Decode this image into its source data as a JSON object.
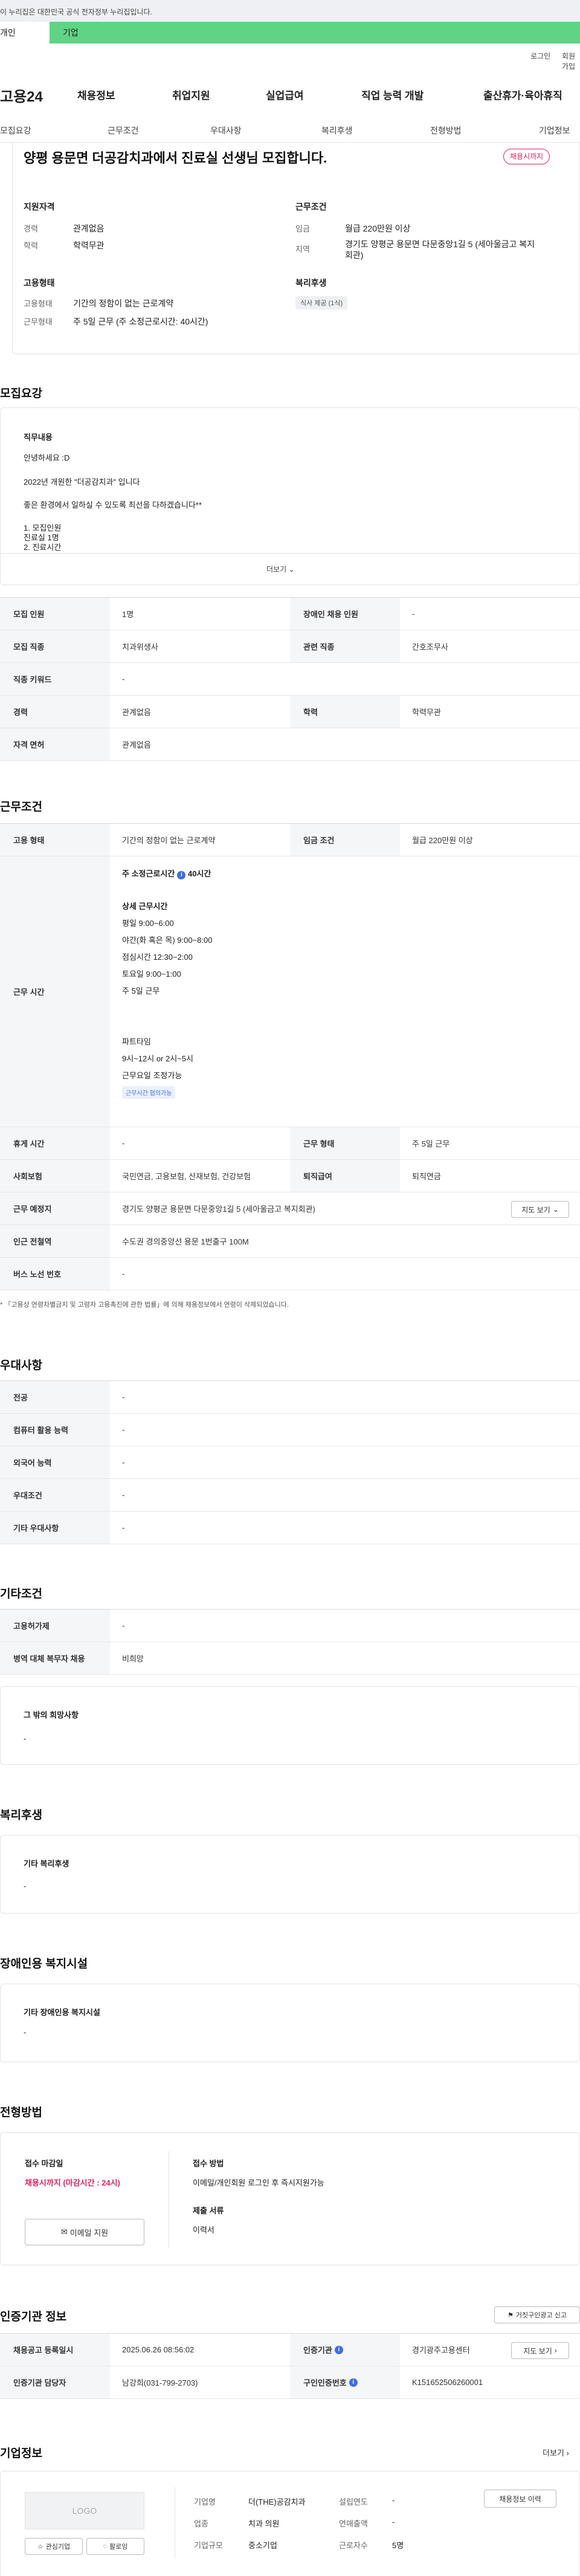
{
  "gov_banner": "이 누리집은 대한민국 공식 전자정부 누리집입니다.",
  "top_tabs": {
    "individual": "개인",
    "corporate": "기업"
  },
  "util": {
    "login": "로그인",
    "join": "회원가입"
  },
  "gnb": {
    "logo": "고용24",
    "menu": [
      "채용정보",
      "취업지원",
      "실업급여",
      "직업 능력 개발",
      "출산휴가·육아휴직"
    ]
  },
  "lnb": [
    "모집요강",
    "근무조건",
    "우대사항",
    "복리후생",
    "전형방법",
    "기업정보"
  ],
  "summary": {
    "title": "양평 용문면 더공감치과에서 진료실 선생님 모집합니다.",
    "deadline_badge": "채용시까지",
    "qual_title": "지원자격",
    "cond_title": "근무조건",
    "career_k": "경력",
    "career_v": "관계없음",
    "edu_k": "학력",
    "edu_v": "학력무관",
    "wage_k": "임금",
    "wage_v": "월급 220만원 이상",
    "region_k": "지역",
    "region_v1": "경기도 양평군 용문면 다문중앙1길 5 (세아울금고 복지",
    "region_v2": "회관)",
    "emp_title": "고용형태",
    "welfare_title": "복리후생",
    "emptype_k": "고용형태",
    "emptype_v": "기간의 정함이 없는 근로계약",
    "worktype_k": "근무형태",
    "worktype_v": "주 5일 근무 (주 소정근로시간: 40시간)",
    "welfare_chip": "식사 제공 (1식)"
  },
  "recruit": {
    "section_title": "모집요강",
    "duty_title": "직무내용",
    "lines": [
      "안녕하세요 :D",
      "2022년 개원한 \"더공감치과\" 입니다",
      "좋은 환경에서 일하실 수 있도록 최선을 다하겠습니다**",
      "1. 모집인원",
      "진료실 1명",
      "2. 진료시간"
    ],
    "more": "더보기",
    "rows": [
      {
        "k1": "모집 인원",
        "v1": "1명",
        "k2": "장애인 채용 인원",
        "v2": "-"
      },
      {
        "k1": "모집 직종",
        "v1": "치과위생사",
        "k2": "관련 직종",
        "v2": "간호조무사"
      },
      {
        "k1": "직종 키워드",
        "v1": "-"
      },
      {
        "k1": "경력",
        "v1": "관계없음",
        "k2": "학력",
        "v2": "학력무관"
      },
      {
        "k1": "자격 면허",
        "v1": "관계없음"
      }
    ]
  },
  "conditions": {
    "section_title": "근무조건",
    "emp_k": "고용 형태",
    "emp_v": "기간의 정함이 없는 근로계약",
    "wage_k": "임금 조건",
    "wage_v": "월급 220만원 이상",
    "time_k": "근무 시간",
    "time_head": "주 소정근로시간",
    "time_head_v": "40시간",
    "detail_title": "상세 근무시간",
    "detail_lines": [
      "평일 9:00~6:00",
      "야간(화 혹은 목) 9:00~8:00",
      "점심시간 12:30~2:00",
      "토요일 9:00~1:00",
      "주 5일 근무",
      "",
      "파트타임",
      "9시~12시 or 2시~5시",
      "근무요일 조정가능"
    ],
    "parttime_badge": "근무시간 협의가능",
    "rest_k": "휴게 시간",
    "rest_v": "-",
    "form_k": "근무 형태",
    "form_v": "주 5일 근무",
    "ins_k": "사회보험",
    "ins_v": "국민연금, 고용보험, 산재보험, 건강보험",
    "sev_k": "퇴직급여",
    "sev_v": "퇴직연금",
    "place_k": "근무 예정지",
    "place_v": "경기도 양평군 용문면 다문중앙1길 5 (세아울금고 복지회관)",
    "map_btn": "지도 보기",
    "subway_k": "인근 전철역",
    "subway_v": "수도권 경의중앙선 용문 1번출구 100M",
    "bus_k": "버스 노선 번호",
    "bus_v": "-",
    "note": "* 「고용상 연령차별금지 및 고령자 고용촉진에 관한 법률」에 의해 채용정보에서 연령이 삭제되었습니다."
  },
  "preference": {
    "section_title": "우대사항",
    "rows": [
      {
        "k": "전공",
        "v": "-"
      },
      {
        "k": "컴퓨터 활용 능력",
        "v": "-"
      },
      {
        "k": "외국어 능력",
        "v": "-"
      },
      {
        "k": "우대조건",
        "v": "-"
      },
      {
        "k": "기타 우대사항",
        "v": "-"
      }
    ]
  },
  "etc": {
    "section_title": "기타조건",
    "rows": [
      {
        "k": "고용허가제",
        "v": "-"
      },
      {
        "k": "병역 대체 복무자 채용",
        "v": "비희망"
      }
    ],
    "box_title": "그 밖의 희망사항",
    "box_v": "-"
  },
  "welfare": {
    "section_title": "복리후생",
    "box_title": "기타 복리후생",
    "box_v": "-"
  },
  "disabled": {
    "section_title": "장애인용 복지시설",
    "box_title": "기타 장애인용 복지시설",
    "box_v": "-"
  },
  "selection": {
    "section_title": "전형방법",
    "deadline_title": "접수 마감일",
    "deadline_v": "채용시까지 (마감시간 : 24시)",
    "email_btn": "이메일 지원",
    "method_title": "접수 방법",
    "method_v": "이메일/개인회원 로그인 후 즉시지원가능",
    "docs_title": "제출 서류",
    "docs_v": "이력서"
  },
  "cert": {
    "section_title": "인증기관 정보",
    "report_btn": "거짓구인광고 신고",
    "reg_k": "채용공고 등록일시",
    "reg_v": "2025.06.26 08:56:02",
    "inst_k": "인증기관",
    "inst_v": "경기광주고용센터",
    "map_btn": "지도 보기",
    "manager_k": "인증기관 담당자",
    "manager_v": "남강희(031-799-2703)",
    "num_k": "구인인증번호",
    "num_v": "K151652506260001"
  },
  "company": {
    "section_title": "기업정보",
    "more": "더보기",
    "logo": "LOGO",
    "fav_btn": "관심기업",
    "follow_btn": "팔로잉",
    "name_k": "기업명",
    "name_v": "더(THE)공감치과",
    "founded_k": "설립연도",
    "founded_v": "-",
    "industry_k": "업종",
    "industry_v": "치과 의원",
    "revenue_k": "연매출액",
    "revenue_v": "-",
    "size_k": "기업규모",
    "size_v": "중소기업",
    "staff_k": "근로자수",
    "staff_v": "5명",
    "history_btn": "채용정보 이력"
  },
  "colors": {
    "accent_green": "#5fd485",
    "deadline_red": "#e0245e",
    "info_blue": "#3d6fe0"
  }
}
